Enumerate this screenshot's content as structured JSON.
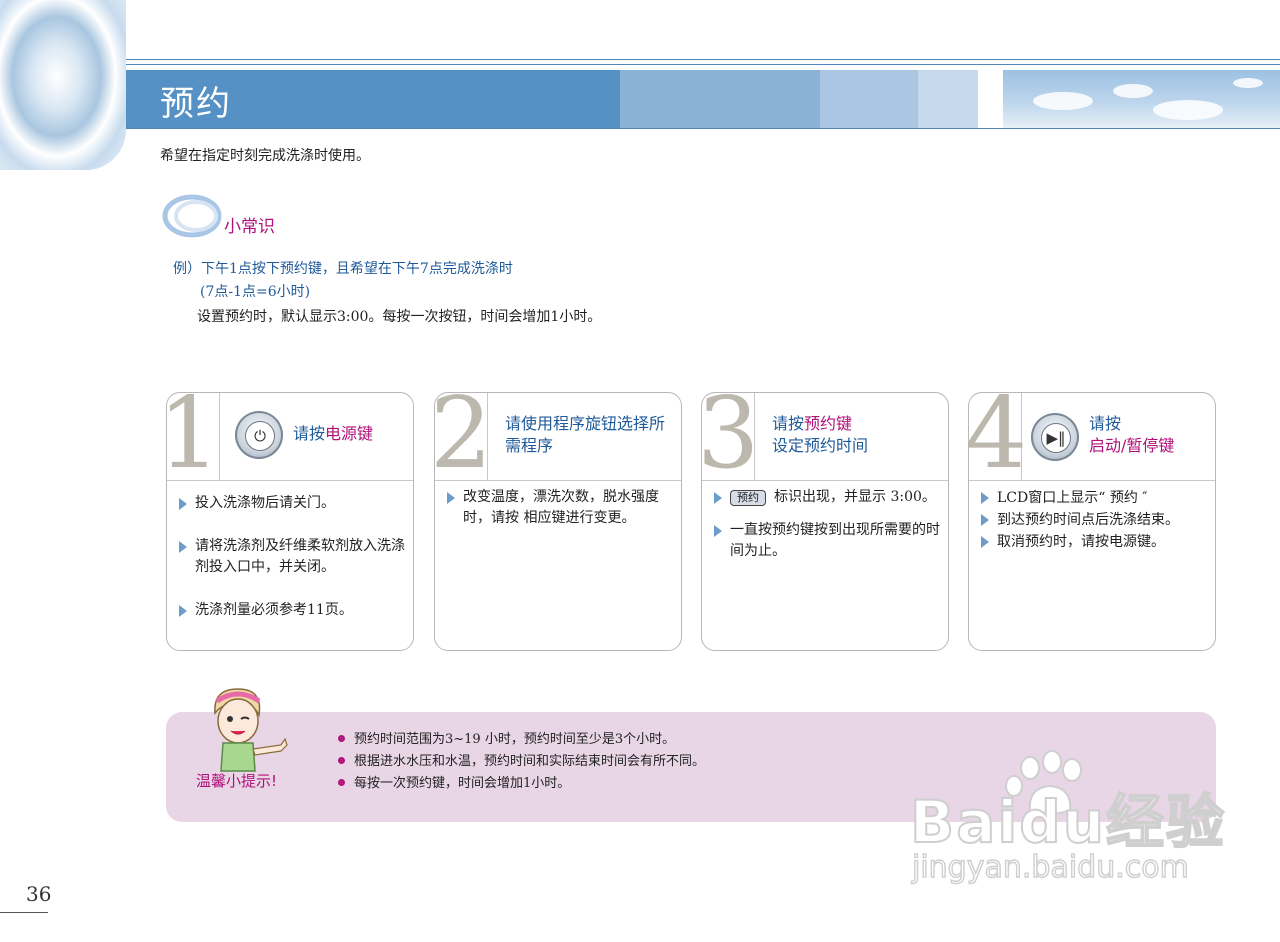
{
  "page": {
    "title": "预约",
    "subtitle": "希望在指定时刻完成洗涤时使用。",
    "page_number": "36"
  },
  "tip": {
    "heading": "小常识",
    "example_line1": "例）下午1点按下预约键，且希望在下午7点完成洗涤时",
    "example_line2": "(7点-1点=6小时)",
    "example_line3": "设置预约时，默认显示3:00。每按一次按钮，时间会增加1小时。"
  },
  "steps": [
    {
      "number": "1",
      "head_part1": "请按",
      "head_highlight": "电源键",
      "icon": "power-icon",
      "bullets": [
        "投入洗涤物后请关门。",
        "请将洗涤剂及纤维柔软剂放入洗涤剂投入口中，并关闭。",
        "洗涤剂量必须参考11页。"
      ]
    },
    {
      "number": "2",
      "head_line1": "请使用程序旋钮选择所",
      "head_line2": "需程序",
      "bullets": [
        "改变温度，漂洗次数，脱水强度时，请按 相应键进行变更。"
      ]
    },
    {
      "number": "3",
      "head_part1": "请按",
      "head_highlight": "预约键",
      "head_line2": "设定预约时间",
      "badge": "预约",
      "bullets": [
        "标识出现，并显示 3:00。",
        "一直按预约键按到出现所需要的时间为止。"
      ]
    },
    {
      "number": "4",
      "head_line1": "请按",
      "head_highlight": "启动/暂停键",
      "icon": "play-pause-icon",
      "bullets": [
        "LCD窗口上显示“ 预约 ″",
        "到达预约时间点后洗涤结束。",
        "取消预约时，请按电源键。"
      ]
    }
  ],
  "warm_tips": {
    "label": "温馨小提示!",
    "items": [
      "预约时间范围为3~19  小时，预约时间至少是3个小时。",
      "根据进水水压和水温，预约时间和实际结束时间会有所不同。",
      "每按一次预约键，时间会增加1小时。"
    ]
  },
  "watermark": {
    "brand": "Baidu经验",
    "url": "jingyan.baidu.com"
  },
  "colors": {
    "title_bar": "#5591c5",
    "accent_blue": "#1f5a9a",
    "accent_magenta": "#b0127a",
    "tip_box": "#e8d5e6"
  }
}
